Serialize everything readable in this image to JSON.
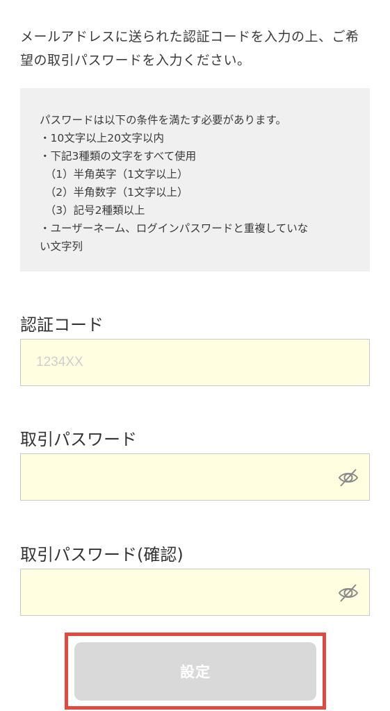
{
  "intro": {
    "line1": "メールアドレスに送られた認証コードを入力の上、ご希",
    "line2": "望の取引パスワードを入力ください。"
  },
  "conditions": {
    "lines": [
      "パスワードは以下の条件を満たす必要があります。",
      "・10文字以上20文字以内",
      "・下記3種類の文字をすべて使用",
      "　（1）半角英字（1文字以上）",
      "　（2）半角数字（1文字以上）",
      "　（3）記号2種類以上",
      "・ユーザーネーム、ログインパスワードと重複していな",
      "い文字列"
    ]
  },
  "fields": {
    "auth_code": {
      "label": "認証コード",
      "placeholder": "1234XX",
      "value": ""
    },
    "password": {
      "label": "取引パスワード",
      "value": ""
    },
    "password_confirm": {
      "label": "取引パスワード(確認)",
      "value": ""
    }
  },
  "submit": {
    "label": "設定"
  },
  "icons": {
    "visibility_toggle": "eye-slash-icon"
  },
  "colors": {
    "input_bg": "#fffee0",
    "conditions_bg": "#f0f0f0",
    "button_disabled_bg": "#d9d9d9",
    "highlight_border": "#e2493f"
  }
}
